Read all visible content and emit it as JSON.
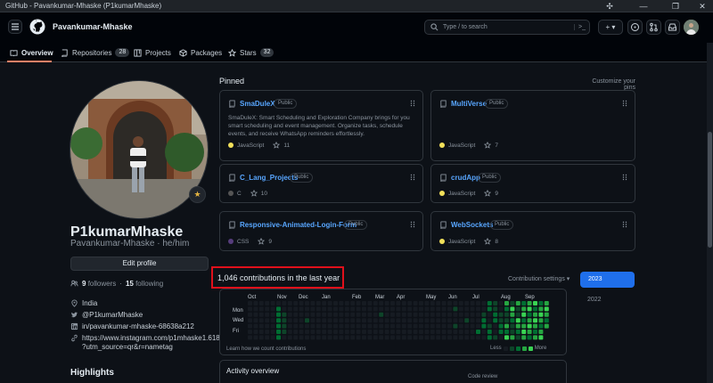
{
  "window": {
    "title": "GitHub - Pavankumar-Mhaske (P1kumarMhaske)",
    "controls": [
      "▭",
      "—",
      "❐",
      "✕"
    ]
  },
  "header": {
    "username": "Pavankumar-Mhaske",
    "search_placeholder": "Type / to search",
    "add_label": "+ ▾"
  },
  "nav": {
    "tabs": [
      {
        "label": "Overview",
        "active": true
      },
      {
        "label": "Repositories",
        "count": "28"
      },
      {
        "label": "Projects"
      },
      {
        "label": "Packages"
      },
      {
        "label": "Stars",
        "count": "32"
      }
    ]
  },
  "profile": {
    "display_name": "P1kumarMhaske",
    "username": "Pavankumar-Mhaske",
    "pronouns": "he/him",
    "edit_label": "Edit profile",
    "followers": "9",
    "followers_label": "followers",
    "following": "15",
    "following_label": "following",
    "location": "India",
    "twitter": "@P1kumarMhaske",
    "linkedin": "in/pavankumar-mhaske-68638a212",
    "instagram_line1": "https://www.instagram.com/p1mhaske1.618",
    "instagram_line2": "?utm_source=qr&r=nametag",
    "highlights_title": "Highlights"
  },
  "pinned": {
    "title": "Pinned",
    "customize": "Customize your pins",
    "repos": [
      {
        "name": "SmaDuleX",
        "visibility": "Public",
        "description": "SmaDuleX: Smart Scheduling and Exploration Company brings for you smart scheduling and event management. Organize tasks, schedule events, and receive WhatsApp reminders effortlessly.",
        "language": "JavaScript",
        "lang_color": "#f1e05a",
        "stars": "11"
      },
      {
        "name": "MultiVerse",
        "visibility": "Public",
        "description": "",
        "language": "JavaScript",
        "lang_color": "#f1e05a",
        "stars": "7"
      },
      {
        "name": "C_Lang_Projects",
        "visibility": "Public",
        "description": "",
        "language": "C",
        "lang_color": "#555555",
        "stars": "10"
      },
      {
        "name": "crudApp",
        "visibility": "Public",
        "description": "",
        "language": "JavaScript",
        "lang_color": "#f1e05a",
        "stars": "9"
      },
      {
        "name": "Responsive-Animated-Login-Form",
        "visibility": "Public",
        "description": "",
        "language": "CSS",
        "lang_color": "#563d7c",
        "stars": "9"
      },
      {
        "name": "WebSockets",
        "visibility": "Public",
        "description": "",
        "language": "JavaScript",
        "lang_color": "#f1e05a",
        "stars": "8"
      }
    ]
  },
  "contributions": {
    "title": "1,046 contributions in the last year",
    "settings": "Contribution settings ▾",
    "months": [
      "Oct",
      "Nov",
      "Dec",
      "Jan",
      "Feb",
      "Mar",
      "Apr",
      "May",
      "Jun",
      "Jul",
      "Aug",
      "Sep"
    ],
    "days": [
      "Mon",
      "Wed",
      "Fri"
    ],
    "learn_link": "Learn how we count contributions",
    "less": "Less",
    "more": "More",
    "level_colors": [
      "#161b22",
      "#0e4429",
      "#006d32",
      "#26a641",
      "#39d353"
    ],
    "years": [
      "2023",
      "2022"
    ]
  },
  "activity": {
    "title": "Activity overview",
    "code_review": "Code review"
  }
}
